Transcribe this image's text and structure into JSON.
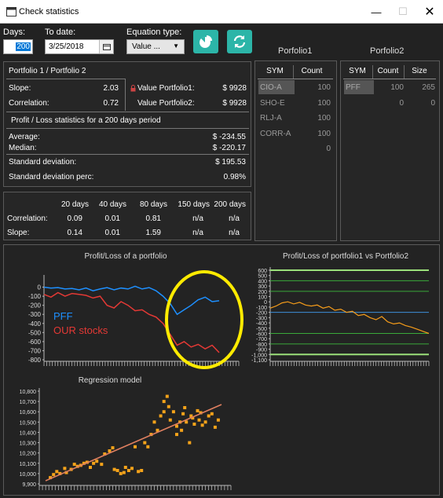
{
  "window": {
    "title": "Check statistics"
  },
  "toolbar": {
    "days_label": "Days:",
    "days_value": "200",
    "todate_label": "To date:",
    "todate_value": "3/25/2018",
    "eqtype_label": "Equation type:",
    "eqtype_value": "Value ...",
    "calendar_icon": "calendar-icon",
    "pie_icon": "pie-chart-icon",
    "refresh_icon": "refresh-icon"
  },
  "stats": {
    "header": "Portfolio 1 / Portfolio 2",
    "slope_label": "Slope:",
    "slope_value": "2.03",
    "corr_label": "Correlation:",
    "corr_value": "0.72",
    "vp1_label": "Value Portfolio1:",
    "vp1_value": "$ 9928",
    "vp2_label": "Value Portfolio2:",
    "vp2_value": "$ 9928",
    "pl_header": "Profit / Loss statistics for a 200 days period",
    "avg_label": "Average:",
    "avg_value": "$ -234.55",
    "med_label": "Median:",
    "med_value": "$ -220.17",
    "sd_label": "Standard deviation:",
    "sd_value": "$ 195.53",
    "sdp_label": "Standard deviation perc:",
    "sdp_value": "0.98%",
    "lock_icon": "lock-icon"
  },
  "periods": {
    "headers": [
      "20 days",
      "40 days",
      "80 days",
      "150 days",
      "200 days"
    ],
    "corr_label": "Correlation:",
    "corr": [
      "0.09",
      "0.01",
      "0.81",
      "n/a",
      "n/a"
    ],
    "slope_label": "Slope:",
    "slope": [
      "0.14",
      "0.01",
      "1.59",
      "n/a",
      "n/a"
    ]
  },
  "portfolio1": {
    "title": "Porfolio1",
    "col_sym": "SYM",
    "col_count": "Count",
    "rows": [
      {
        "sym": "CIO-A",
        "count": "100"
      },
      {
        "sym": "SHO-E",
        "count": "100"
      },
      {
        "sym": "RLJ-A",
        "count": "100"
      },
      {
        "sym": "CORR-A",
        "count": "100"
      },
      {
        "sym": "",
        "count": "0"
      }
    ]
  },
  "portfolio2": {
    "title": "Porfolio2",
    "col_sym": "SYM",
    "col_count": "Count",
    "col_size": "Size",
    "rows": [
      {
        "sym": "PFF",
        "count": "100",
        "size": "265"
      },
      {
        "sym": "",
        "count": "0",
        "size": "0"
      }
    ]
  },
  "chart_data": [
    {
      "type": "line",
      "title": "Profit/Loss of a portfolio",
      "yticks": [
        "0",
        "-100",
        "-200",
        "-300",
        "-400",
        "-500",
        "-600",
        "-700",
        "-800"
      ],
      "ylim": [
        -800,
        100
      ],
      "series": [
        {
          "name": "PFF",
          "color": "#1e90ff",
          "values": [
            0,
            -10,
            -5,
            -20,
            -15,
            -30,
            -10,
            -40,
            -20,
            -5,
            -30,
            -10,
            -20,
            10,
            -20,
            -5,
            -40,
            -100,
            -180,
            -300,
            -250,
            -200,
            -140,
            -110,
            -160,
            -150
          ]
        },
        {
          "name": "OUR stocks",
          "color": "#e53935",
          "values": [
            -80,
            -110,
            -60,
            -100,
            -70,
            -80,
            -90,
            -120,
            -100,
            -200,
            -230,
            -160,
            -200,
            -260,
            -250,
            -300,
            -330,
            -400,
            -520,
            -640,
            -600,
            -660,
            -630,
            -680,
            -640,
            -720
          ]
        }
      ]
    },
    {
      "type": "line",
      "title": "Profit/Loss of portfolio1 vs Portfolio2",
      "yticks": [
        "600",
        "500",
        "400",
        "300",
        "200",
        "100",
        "0",
        "-100",
        "-200",
        "-300",
        "-400",
        "-500",
        "-600",
        "-700",
        "-800",
        "-900",
        "-1,000",
        "-1,100"
      ],
      "ylim": [
        -1100,
        600
      ],
      "hlines": [
        {
          "y": 600,
          "color": "#9be07a"
        },
        {
          "y": 400,
          "color": "#3aa93a"
        },
        {
          "y": 200,
          "color": "#3aa93a"
        },
        {
          "y": -200,
          "color": "#3d8fd8"
        },
        {
          "y": -600,
          "color": "#3aa93a"
        },
        {
          "y": -800,
          "color": "#3aa93a"
        },
        {
          "y": -1000,
          "color": "#9be07a"
        }
      ],
      "series": [
        {
          "color": "#f59c1a",
          "values": [
            -120,
            -80,
            -20,
            0,
            -40,
            -10,
            -60,
            -80,
            -60,
            -120,
            -90,
            -160,
            -140,
            -200,
            -180,
            -260,
            -240,
            -300,
            -340,
            -280,
            -380,
            -420,
            -400,
            -450,
            -480,
            -520,
            -560,
            -600
          ]
        }
      ]
    },
    {
      "type": "scatter",
      "title": "Regression model",
      "yticks": [
        "10,800",
        "10,700",
        "10,600",
        "10,500",
        "10,400",
        "10,300",
        "10,200",
        "10,100",
        "10,000",
        "9,900"
      ],
      "ylim": [
        9900,
        10800
      ],
      "points": [
        [
          0.03,
          9960
        ],
        [
          0.05,
          9990
        ],
        [
          0.07,
          10020
        ],
        [
          0.09,
          10000
        ],
        [
          0.12,
          10050
        ],
        [
          0.13,
          10010
        ],
        [
          0.16,
          10040
        ],
        [
          0.18,
          10090
        ],
        [
          0.2,
          10070
        ],
        [
          0.22,
          10080
        ],
        [
          0.24,
          10100
        ],
        [
          0.26,
          10110
        ],
        [
          0.28,
          10060
        ],
        [
          0.3,
          10100
        ],
        [
          0.32,
          10120
        ],
        [
          0.35,
          10090
        ],
        [
          0.37,
          10190
        ],
        [
          0.4,
          10220
        ],
        [
          0.42,
          10250
        ],
        [
          0.43,
          10040
        ],
        [
          0.45,
          10030
        ],
        [
          0.47,
          10000
        ],
        [
          0.49,
          10010
        ],
        [
          0.5,
          10060
        ],
        [
          0.52,
          10030
        ],
        [
          0.54,
          10050
        ],
        [
          0.56,
          10260
        ],
        [
          0.58,
          10020
        ],
        [
          0.6,
          10030
        ],
        [
          0.62,
          10300
        ],
        [
          0.64,
          10260
        ],
        [
          0.66,
          10380
        ],
        [
          0.68,
          10500
        ],
        [
          0.7,
          10420
        ],
        [
          0.72,
          10560
        ],
        [
          0.74,
          10700
        ],
        [
          0.74,
          10600
        ],
        [
          0.76,
          10750
        ],
        [
          0.77,
          10650
        ],
        [
          0.78,
          10520
        ],
        [
          0.8,
          10600
        ],
        [
          0.82,
          10460
        ],
        [
          0.82,
          10380
        ],
        [
          0.84,
          10500
        ],
        [
          0.85,
          10420
        ],
        [
          0.86,
          10580
        ],
        [
          0.87,
          10640
        ],
        [
          0.88,
          10500
        ],
        [
          0.9,
          10300
        ],
        [
          0.91,
          10560
        ],
        [
          0.92,
          10540
        ],
        [
          0.93,
          10480
        ],
        [
          0.95,
          10610
        ],
        [
          0.96,
          10520
        ],
        [
          0.97,
          10590
        ],
        [
          0.98,
          10470
        ],
        [
          1.0,
          10500
        ],
        [
          1.02,
          10560
        ],
        [
          1.04,
          10580
        ],
        [
          1.06,
          10450
        ],
        [
          1.08,
          10520
        ]
      ],
      "fit": [
        [
          0.0,
          9930
        ],
        [
          1.1,
          10670
        ]
      ],
      "point_color": "#f5a31a",
      "fit_color": "#e08060"
    }
  ]
}
